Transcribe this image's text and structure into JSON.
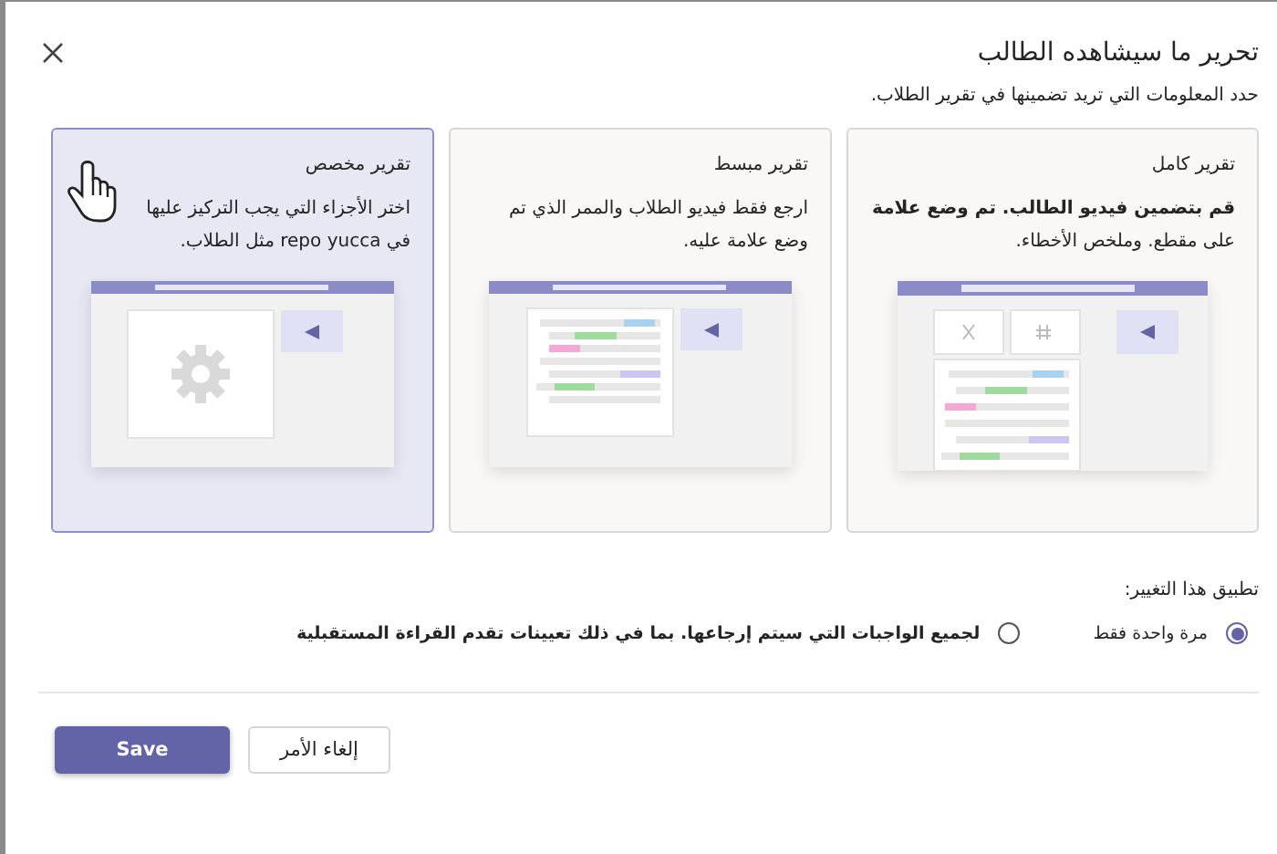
{
  "dialog": {
    "title": "تحرير ما سيشاهده الطالب",
    "subtitle": "حدد المعلومات التي تريد تضمينها في تقرير الطلاب."
  },
  "cards": [
    {
      "kind": "full",
      "title": "تقرير كامل",
      "description": "**قم بتضمين فيديو الطالب. تم وضع علامة** على مقطع. وملخص الأخطاء.",
      "selected": false
    },
    {
      "kind": "simple",
      "title": "تقرير مبسط",
      "description": "ارجع فقط فيديو الطلاب والممر الذي تم وضع علامة عليه.",
      "selected": false
    },
    {
      "kind": "custom",
      "title": "تقرير مخصص",
      "description": "اختر الأجزاء التي يجب التركيز عليها في repo yucca مثل الطلاب.",
      "selected": true
    }
  ],
  "apply": {
    "label": "تطبيق هذا التغيير:",
    "options": [
      {
        "label": "مرة واحدة فقط",
        "selected": true
      },
      {
        "label": "لجميع الواجبات التي سيتم إرجاعها. بما في ذلك تعيينات تقدم القراءة المستقبلية",
        "selected": false
      }
    ]
  },
  "buttons": {
    "save": "Save",
    "cancel": "إلغاء الأمر"
  }
}
